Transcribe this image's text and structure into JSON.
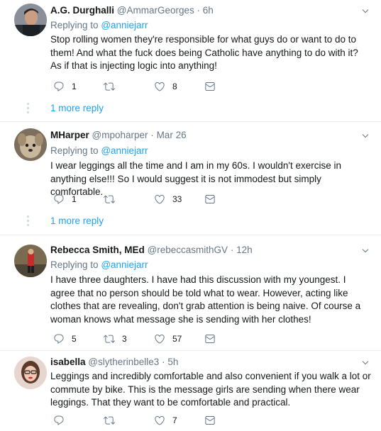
{
  "tweets": [
    {
      "name": "A.G. Durghalli",
      "handle": "@AmmarGeorges",
      "time": "6h",
      "replying_label": "Replying to",
      "replying_to": "@anniejarr",
      "text": "Stop rolling women they're responsible for what guys do or want to do to them! And what the fuck does being Catholic have anything to do with it? As if that is injecting logic into anything!",
      "reply_count": "1",
      "retweet_count": "",
      "like_count": "8",
      "more_replies": "1 more reply"
    },
    {
      "name": "MHarper",
      "handle": "@mpoharper",
      "time": "Mar 26",
      "replying_label": "Replying to",
      "replying_to": "@anniejarr",
      "text": "I wear leggings all the time and I am in my 60s.  I wouldn't exercise in anything else!!! So I would suggest it is not immodest but simply comfortable.",
      "reply_count": "1",
      "retweet_count": "",
      "like_count": "33",
      "more_replies": "1 more reply"
    },
    {
      "name": "Rebecca Smith, MEd",
      "handle": "@rebeccasmithGV",
      "time": "12h",
      "replying_label": "Replying to",
      "replying_to": "@anniejarr",
      "text": "I have three daughters. I have had this discussion with my youngest. I agree that no person should be told what to wear. However, acting like clothes that are revealing, don't grab attention is being naive. Of course a woman knows what message she is sending with her clothes!",
      "reply_count": "5",
      "retweet_count": "3",
      "like_count": "57"
    },
    {
      "name": "isabella",
      "handle": "@slytherinbelle3",
      "time": "5h",
      "text": "Leggings and incredibly comfortable and also convenient if you walk a lot or commute by bike. This is the message girls are sending when there wear leggings. That they want to be comfortable and practical.",
      "reply_count": "",
      "retweet_count": "",
      "like_count": "7"
    }
  ],
  "separator": "·",
  "icons": {
    "reply": "reply-icon",
    "retweet": "retweet-icon",
    "like": "heart-icon",
    "dm": "envelope-icon",
    "menu": "chevron-down-icon"
  },
  "colors": {
    "link": "#1da1f2",
    "muted": "#657786",
    "text": "#14171a",
    "divider": "#e6ecf0"
  }
}
